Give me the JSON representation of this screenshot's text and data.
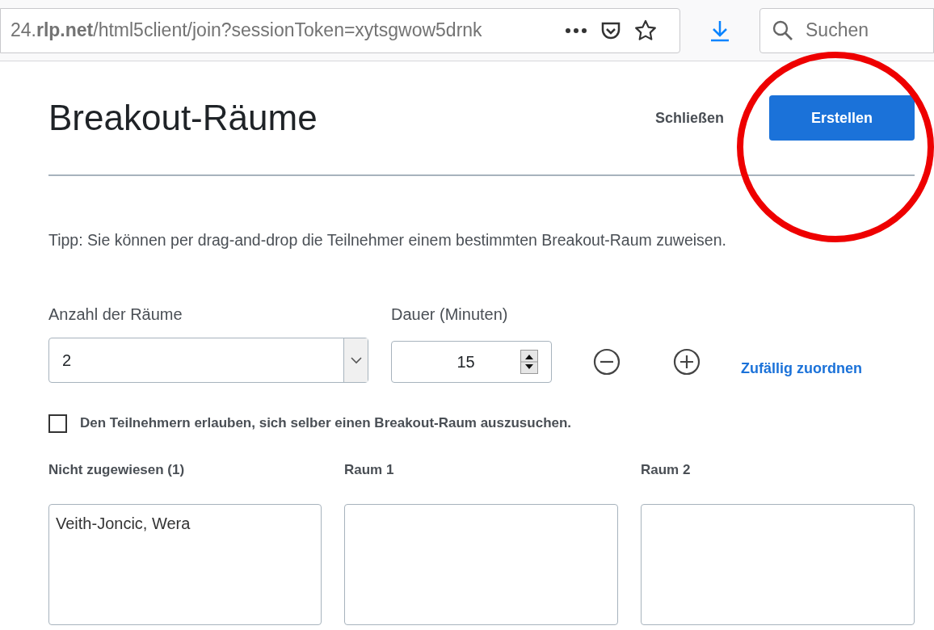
{
  "browser": {
    "url": "24.**rlp.net**/html5client/join?sessionToken=xytsgwow5drnk",
    "search": {
      "placeholder": "Suchen"
    }
  },
  "dialog": {
    "title": "Breakout-Räume",
    "close": "Schließen",
    "create": "Erstellen",
    "tip": "Tipp: Sie können per drag-and-drop die Teilnehmer einem bestimmten Breakout-Raum zuweisen.",
    "rooms_label": "Anzahl der Räume",
    "rooms_value": "2",
    "duration_label": "Dauer (Minuten)",
    "duration_value": "15",
    "random_link": "Zufällig zuordnen",
    "self_select": {
      "label": "Den Teilnehmern erlauben, sich selber einen Breakout-Raum auszusuchen.",
      "checked": false
    },
    "columns": [
      {
        "title": "Nicht zugewiesen (1)",
        "members": [
          "Veith-Joncic, Wera"
        ]
      },
      {
        "title": "Raum 1"
      },
      {
        "title": "Raum 2"
      }
    ]
  }
}
